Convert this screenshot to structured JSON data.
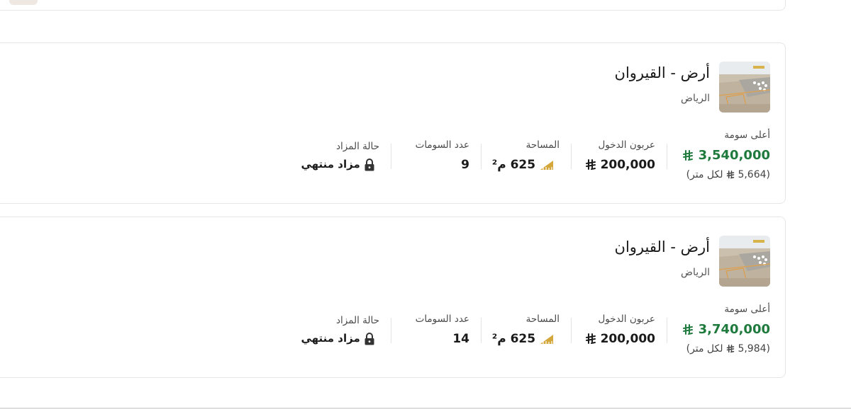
{
  "cards": [
    {
      "title": "أرض - القيروان",
      "city": "الرياض",
      "highest_bid_label": "أعلى سومة",
      "highest_bid_value": "3,540,000",
      "per_meter_open": "(",
      "per_meter_value": "5,664",
      "per_meter_suffix": "لكل متر)",
      "deposit_label": "عربون الدخول",
      "deposit_value": "200,000",
      "area_label": "المساحة",
      "area_value": "625 م²",
      "bids_label": "عدد السومات",
      "bids_value": "9",
      "status_label": "حالة المزاد",
      "status_value": "مزاد منتهي"
    },
    {
      "title": "أرض - القيروان",
      "city": "الرياض",
      "highest_bid_label": "أعلى سومة",
      "highest_bid_value": "3,740,000",
      "per_meter_open": "(",
      "per_meter_value": "5,984",
      "per_meter_suffix": "لكل متر)",
      "deposit_label": "عربون الدخول",
      "deposit_value": "200,000",
      "area_label": "المساحة",
      "area_value": "625 م²",
      "bids_label": "عدد السومات",
      "bids_value": "14",
      "status_label": "حالة المزاد",
      "status_value": "مزاد منتهي"
    }
  ],
  "icons": {
    "currency": "riyal-icon",
    "area": "ruler-icon",
    "status": "lock-icon",
    "thumbnail": "land-photo"
  },
  "colors": {
    "price_green": "#1f7a3d",
    "ruler_gold": "#d4a73a",
    "card_border": "#e6e6e6"
  }
}
